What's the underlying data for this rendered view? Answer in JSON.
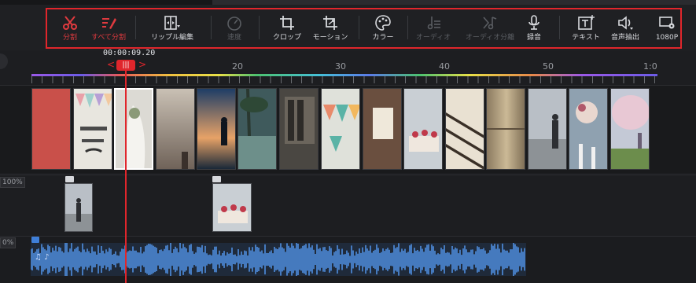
{
  "toolbar": {
    "tools": [
      {
        "id": "split",
        "label": "分割",
        "icon": "scissors-icon",
        "state": "red"
      },
      {
        "id": "split-all",
        "label": "すべて分割",
        "icon": "split-all-icon",
        "state": "red"
      },
      {
        "id": "ripple-edit",
        "label": "リップル編集",
        "icon": "ripple-edit-icon",
        "state": "lit"
      },
      {
        "id": "speed",
        "label": "速度",
        "icon": "speedometer-icon",
        "state": "dim"
      },
      {
        "id": "crop",
        "label": "クロップ",
        "icon": "crop-icon",
        "state": "lit"
      },
      {
        "id": "motion",
        "label": "モーション",
        "icon": "motion-crop-icon",
        "state": "lit"
      },
      {
        "id": "color",
        "label": "カラー",
        "icon": "palette-icon",
        "state": "lit"
      },
      {
        "id": "audio",
        "label": "オーディオ",
        "icon": "audio-notes-icon",
        "state": "dim"
      },
      {
        "id": "audio-split",
        "label": "オーディオ分離",
        "icon": "audio-split-icon",
        "state": "dim"
      },
      {
        "id": "record",
        "label": "録音",
        "icon": "microphone-icon",
        "state": "lit"
      },
      {
        "id": "text",
        "label": "テキスト",
        "icon": "text-box-icon",
        "state": "lit"
      },
      {
        "id": "extract-voice",
        "label": "音声抽出",
        "icon": "speaker-icon",
        "state": "lit"
      },
      {
        "id": "resolution",
        "label": "1080P",
        "icon": "monitor-settings-icon",
        "state": "lit"
      }
    ],
    "accent_color": "#e0262c"
  },
  "ruler": {
    "timecode": "00:00:09.20",
    "ticks": [
      "20",
      "30",
      "40",
      "50",
      "1:0"
    ],
    "playhead_grip": "|||"
  },
  "tracks": {
    "overlay_volume": "100%",
    "audio_volume": "0%",
    "audio_clip_label": "♫ ♪"
  }
}
